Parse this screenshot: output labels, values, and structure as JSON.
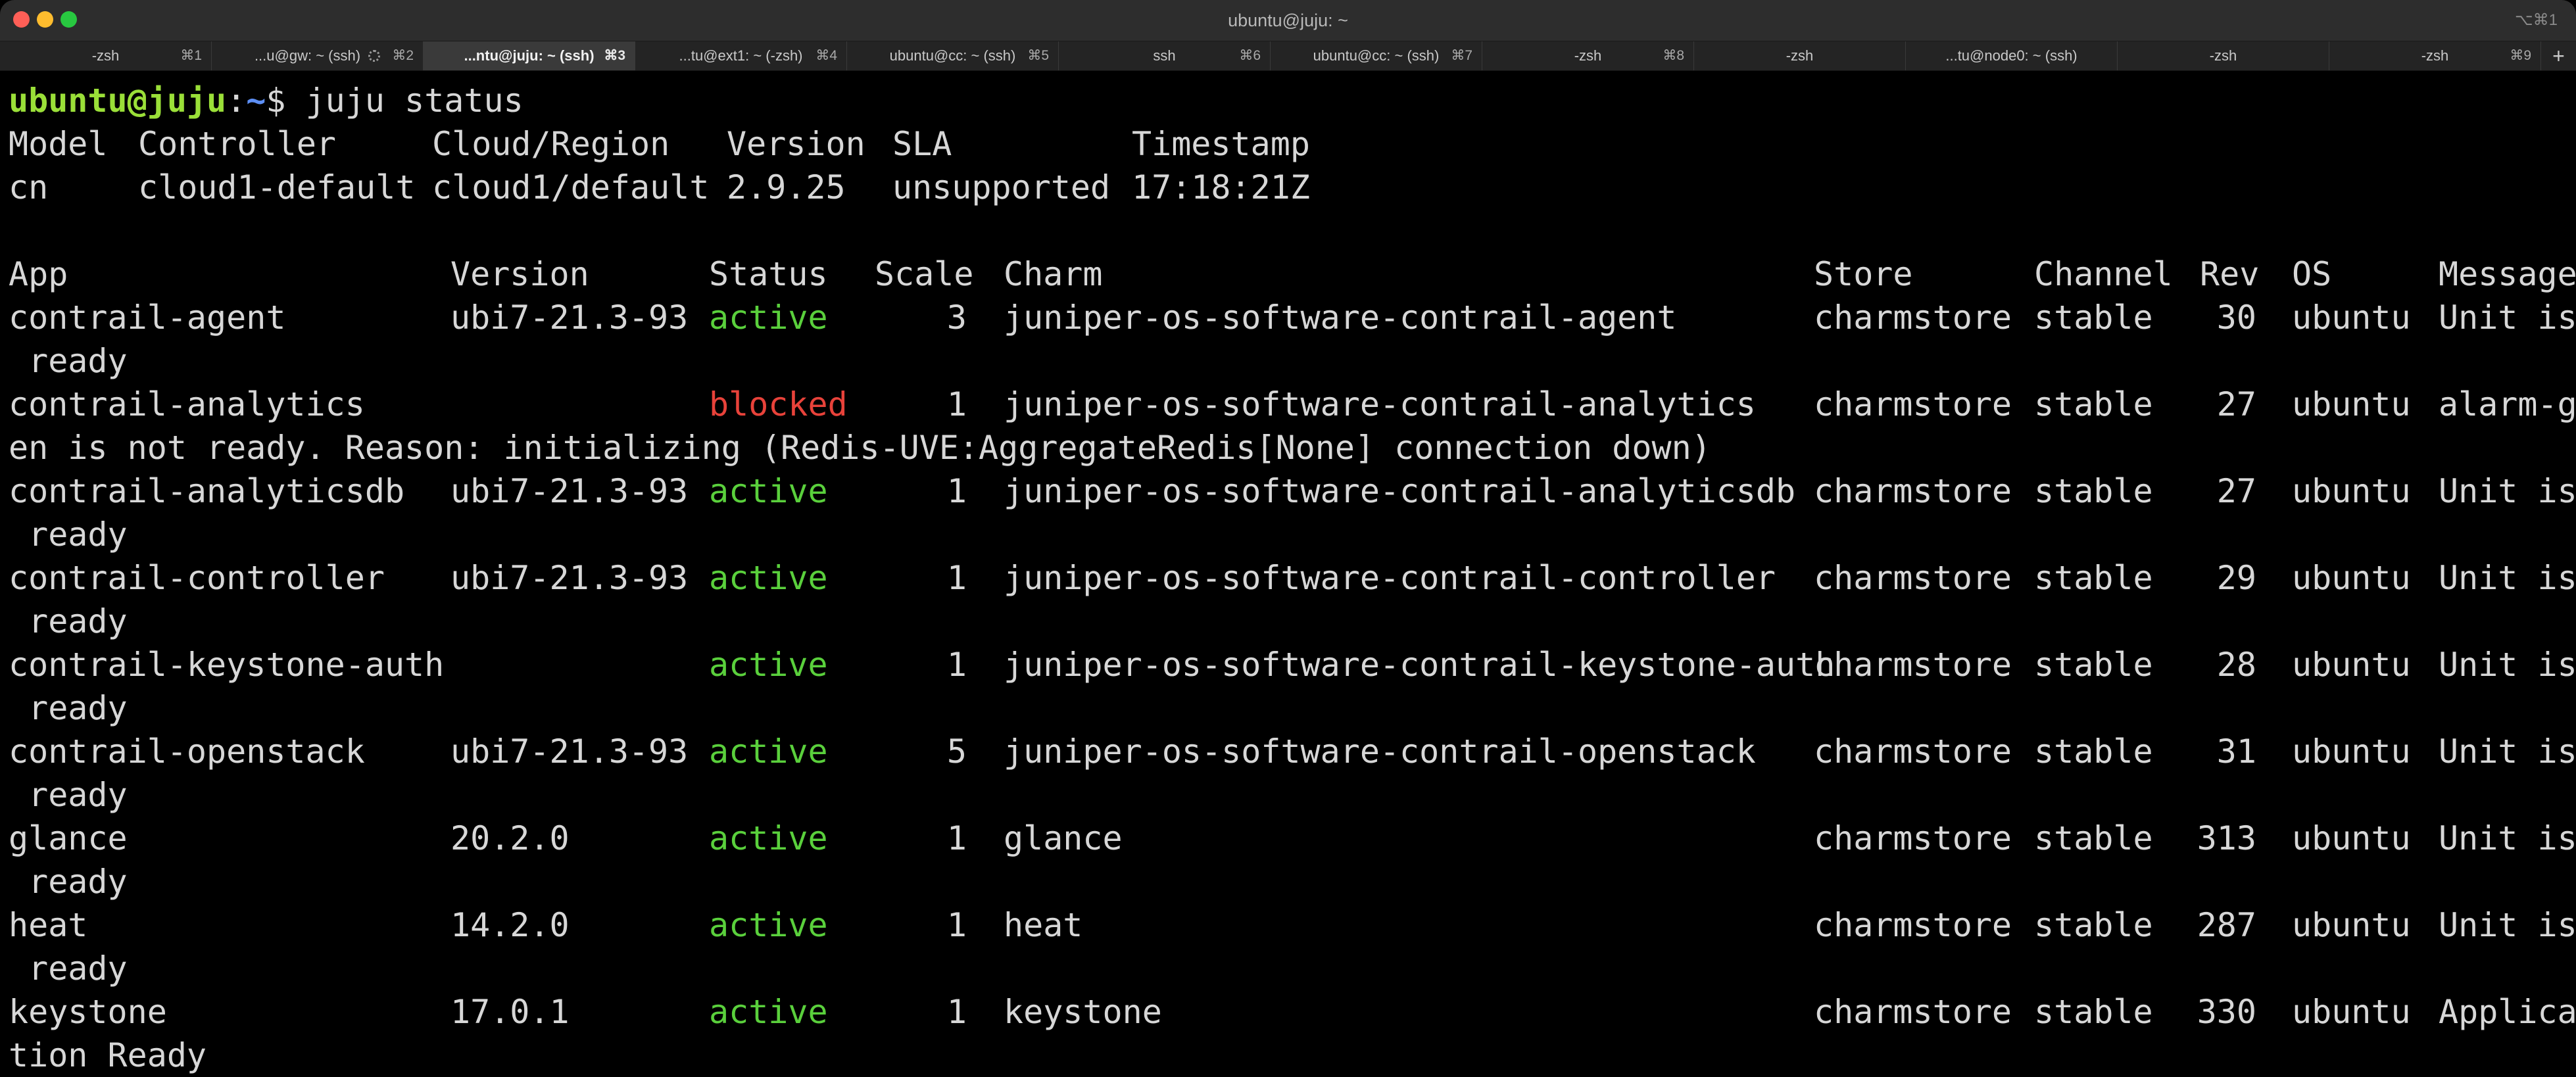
{
  "window": {
    "title": "ubuntu@juju: ~",
    "shortcut": "⌥⌘1"
  },
  "tabs": [
    {
      "label": "-zsh",
      "shortcut": "⌘1"
    },
    {
      "label": "...u@gw: ~ (ssh)",
      "shortcut": "⌘2",
      "busy": true
    },
    {
      "label": "...ntu@juju: ~ (ssh)",
      "shortcut": "⌘3",
      "active": true
    },
    {
      "label": "...tu@ext1: ~ (-zsh)",
      "shortcut": "⌘4"
    },
    {
      "label": "ubuntu@cc: ~ (ssh)",
      "shortcut": "⌘5"
    },
    {
      "label": "ssh",
      "shortcut": "⌘6"
    },
    {
      "label": "ubuntu@cc: ~ (ssh)",
      "shortcut": "⌘7"
    },
    {
      "label": "-zsh",
      "shortcut": "⌘8"
    },
    {
      "label": "-zsh",
      "shortcut": ""
    },
    {
      "label": "...tu@node0: ~ (ssh)",
      "shortcut": ""
    },
    {
      "label": "-zsh",
      "shortcut": ""
    },
    {
      "label": "-zsh",
      "shortcut": "⌘9"
    }
  ],
  "tab_add_label": "+",
  "terminal": {
    "prompt": {
      "user_host": "ubuntu@juju",
      "sep": ":",
      "path": "~",
      "symbol": "$ ",
      "command": "juju status"
    },
    "model_header": {
      "model": "Model",
      "controller": "Controller",
      "cloud": "Cloud/Region",
      "version": "Version",
      "sla": "SLA",
      "timestamp": "Timestamp"
    },
    "model_row": {
      "model": "cn",
      "controller": "cloud1-default",
      "cloud": "cloud1/default",
      "version": "2.9.25",
      "sla": "unsupported",
      "timestamp": "17:18:21Z"
    },
    "app_header": {
      "app": "App",
      "version": "Version",
      "status": "Status",
      "scale": "Scale",
      "charm": "Charm",
      "store": "Store",
      "channel": "Channel",
      "rev": "Rev",
      "os": "OS",
      "message": "Message"
    },
    "apps": [
      {
        "app": "contrail-agent",
        "version": "ubi7-21.3-93",
        "status": "active",
        "scale": "3",
        "charm": "juniper-os-software-contrail-agent",
        "store": "charmstore",
        "channel": "stable",
        "rev": "30",
        "os": "ubuntu",
        "message": "Unit is",
        "cont": " ready"
      },
      {
        "app": "contrail-analytics",
        "version": "",
        "status": "blocked",
        "scale": "1",
        "charm": "juniper-os-software-contrail-analytics",
        "store": "charmstore",
        "channel": "stable",
        "rev": "27",
        "os": "ubuntu",
        "message": "alarm-g",
        "cont": "en is not ready. Reason: initializing (Redis-UVE:AggregateRedis[None] connection down)"
      },
      {
        "app": "contrail-analyticsdb",
        "version": "ubi7-21.3-93",
        "status": "active",
        "scale": "1",
        "charm": "juniper-os-software-contrail-analyticsdb",
        "store": "charmstore",
        "channel": "stable",
        "rev": "27",
        "os": "ubuntu",
        "message": "Unit is",
        "cont": " ready"
      },
      {
        "app": "contrail-controller",
        "version": "ubi7-21.3-93",
        "status": "active",
        "scale": "1",
        "charm": "juniper-os-software-contrail-controller",
        "store": "charmstore",
        "channel": "stable",
        "rev": "29",
        "os": "ubuntu",
        "message": "Unit is",
        "cont": " ready"
      },
      {
        "app": "contrail-keystone-auth",
        "version": "",
        "status": "active",
        "scale": "1",
        "charm": "juniper-os-software-contrail-keystone-auth",
        "store": "charmstore",
        "channel": "stable",
        "rev": "28",
        "os": "ubuntu",
        "message": "Unit is",
        "cont": " ready"
      },
      {
        "app": "contrail-openstack",
        "version": "ubi7-21.3-93",
        "status": "active",
        "scale": "5",
        "charm": "juniper-os-software-contrail-openstack",
        "store": "charmstore",
        "channel": "stable",
        "rev": "31",
        "os": "ubuntu",
        "message": "Unit is",
        "cont": " ready"
      },
      {
        "app": "glance",
        "version": "20.2.0",
        "status": "active",
        "scale": "1",
        "charm": "glance",
        "store": "charmstore",
        "channel": "stable",
        "rev": "313",
        "os": "ubuntu",
        "message": "Unit is",
        "cont": " ready"
      },
      {
        "app": "heat",
        "version": "14.2.0",
        "status": "active",
        "scale": "1",
        "charm": "heat",
        "store": "charmstore",
        "channel": "stable",
        "rev": "287",
        "os": "ubuntu",
        "message": "Unit is",
        "cont": " ready"
      },
      {
        "app": "keystone",
        "version": "17.0.1",
        "status": "active",
        "scale": "1",
        "charm": "keystone",
        "store": "charmstore",
        "channel": "stable",
        "rev": "330",
        "os": "ubuntu",
        "message": "Applica",
        "cont": "tion Ready"
      }
    ],
    "colors": {
      "user": "#9adf38",
      "path": "#5d8ff5",
      "active": "#5ad03c",
      "blocked": "#e8423a"
    }
  }
}
